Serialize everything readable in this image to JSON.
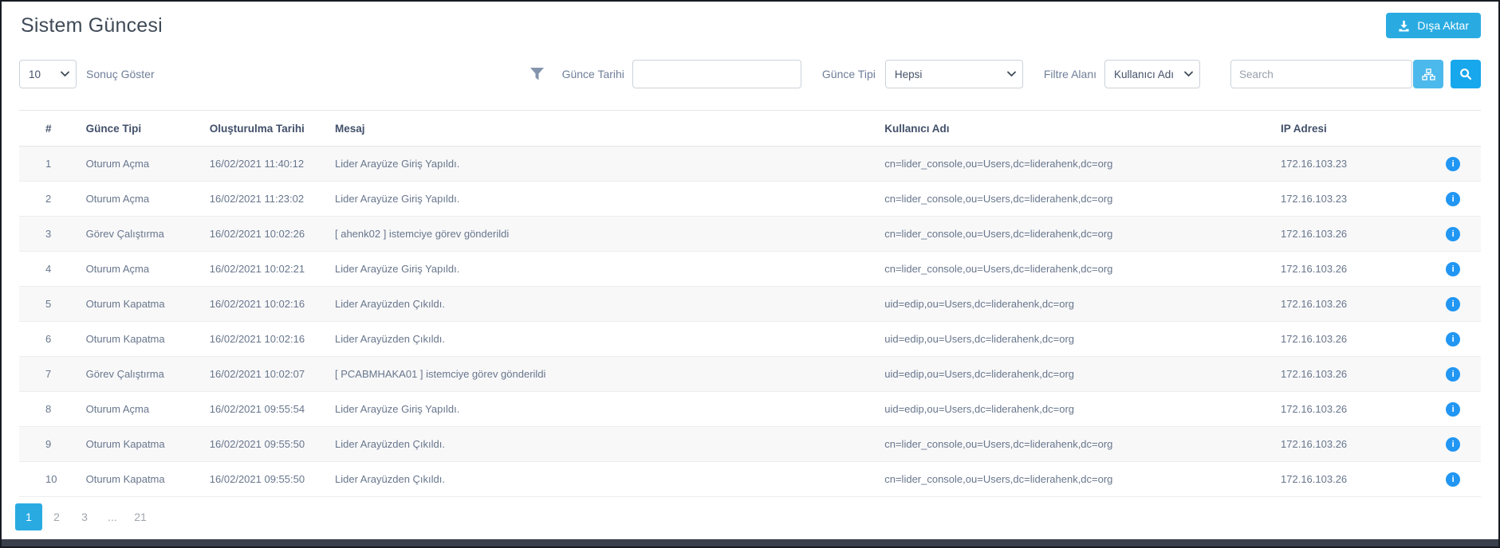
{
  "colors": {
    "accent": "#29abe2",
    "info": "#2196f3"
  },
  "page": {
    "title": "Sistem Güncesi",
    "export_button": "Dışa Aktar"
  },
  "controls": {
    "page_size_value": "10",
    "page_size_label": "Sonuç Göster",
    "date_label": "Günce Tarihi",
    "date_value": "",
    "type_label": "Günce Tipi",
    "type_value": "Hepsi",
    "filter_field_label": "Filtre Alanı",
    "filter_field_value": "Kullanıcı Adı",
    "search_placeholder": "Search"
  },
  "table": {
    "columns": [
      "#",
      "Günce Tipi",
      "Oluşturulma Tarihi",
      "Mesaj",
      "Kullanıcı Adı",
      "IP Adresi"
    ],
    "rows": [
      {
        "num": "1",
        "type": "Oturum Açma",
        "created": "16/02/2021 11:40:12",
        "message": "Lider Arayüze Giriş Yapıldı.",
        "user": "cn=lider_console,ou=Users,dc=liderahenk,dc=org",
        "ip": "172.16.103.23"
      },
      {
        "num": "2",
        "type": "Oturum Açma",
        "created": "16/02/2021 11:23:02",
        "message": "Lider Arayüze Giriş Yapıldı.",
        "user": "cn=lider_console,ou=Users,dc=liderahenk,dc=org",
        "ip": "172.16.103.23"
      },
      {
        "num": "3",
        "type": "Görev Çalıştırma",
        "created": "16/02/2021 10:02:26",
        "message": "[ ahenk02 ] istemciye görev gönderildi",
        "user": "cn=lider_console,ou=Users,dc=liderahenk,dc=org",
        "ip": "172.16.103.26"
      },
      {
        "num": "4",
        "type": "Oturum Açma",
        "created": "16/02/2021 10:02:21",
        "message": "Lider Arayüze Giriş Yapıldı.",
        "user": "cn=lider_console,ou=Users,dc=liderahenk,dc=org",
        "ip": "172.16.103.26"
      },
      {
        "num": "5",
        "type": "Oturum Kapatma",
        "created": "16/02/2021 10:02:16",
        "message": "Lider Arayüzden Çıkıldı.",
        "user": "uid=edip,ou=Users,dc=liderahenk,dc=org",
        "ip": "172.16.103.26"
      },
      {
        "num": "6",
        "type": "Oturum Kapatma",
        "created": "16/02/2021 10:02:16",
        "message": "Lider Arayüzden Çıkıldı.",
        "user": "uid=edip,ou=Users,dc=liderahenk,dc=org",
        "ip": "172.16.103.26"
      },
      {
        "num": "7",
        "type": "Görev Çalıştırma",
        "created": "16/02/2021 10:02:07",
        "message": "[ PCABMHAKA01 ] istemciye görev gönderildi",
        "user": "uid=edip,ou=Users,dc=liderahenk,dc=org",
        "ip": "172.16.103.26"
      },
      {
        "num": "8",
        "type": "Oturum Açma",
        "created": "16/02/2021 09:55:54",
        "message": "Lider Arayüze Giriş Yapıldı.",
        "user": "uid=edip,ou=Users,dc=liderahenk,dc=org",
        "ip": "172.16.103.26"
      },
      {
        "num": "9",
        "type": "Oturum Kapatma",
        "created": "16/02/2021 09:55:50",
        "message": "Lider Arayüzden Çıkıldı.",
        "user": "cn=lider_console,ou=Users,dc=liderahenk,dc=org",
        "ip": "172.16.103.26"
      },
      {
        "num": "10",
        "type": "Oturum Kapatma",
        "created": "16/02/2021 09:55:50",
        "message": "Lider Arayüzden Çıkıldı.",
        "user": "cn=lider_console,ou=Users,dc=liderahenk,dc=org",
        "ip": "172.16.103.26"
      }
    ]
  },
  "pagination": {
    "pages": [
      {
        "label": "1",
        "active": true
      },
      {
        "label": "2",
        "active": false
      },
      {
        "label": "3",
        "active": false
      },
      {
        "label": "...",
        "active": false
      },
      {
        "label": "21",
        "active": false
      }
    ]
  }
}
